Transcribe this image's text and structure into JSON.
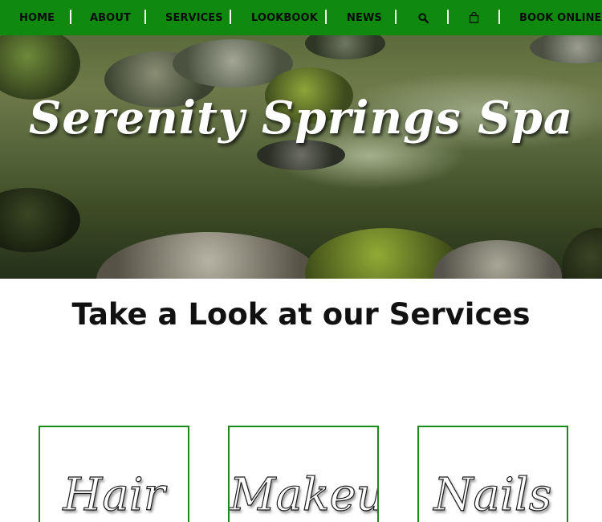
{
  "nav": {
    "items": [
      {
        "label": "HOME"
      },
      {
        "label": "ABOUT"
      },
      {
        "label": "SERVICES"
      },
      {
        "label": "LOOKBOOK"
      },
      {
        "label": "NEWS"
      }
    ],
    "search_icon": "search-icon",
    "cart_icon": "shopping-bag-icon",
    "book_label": "BOOK ONLINE",
    "bg_color": "#0f8a0f"
  },
  "hero": {
    "title": "Serenity Springs Spa"
  },
  "services": {
    "heading": "Take a Look at our Services",
    "cards": [
      {
        "label": "Hair"
      },
      {
        "label": "Makeup"
      },
      {
        "label": "Nails"
      }
    ],
    "border_color": "#1a8a1a"
  }
}
